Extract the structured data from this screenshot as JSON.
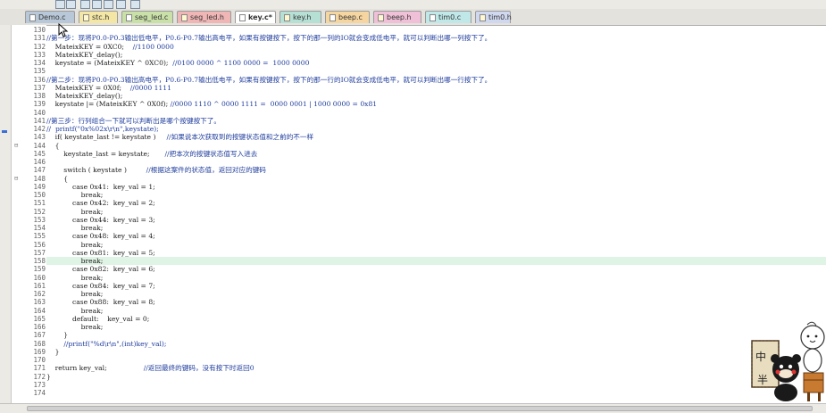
{
  "tabs": [
    {
      "label": "Demo.c",
      "kind": "c",
      "color": "#b8c8d8",
      "active": false
    },
    {
      "label": "stc.h",
      "kind": "h",
      "color": "#f4e7a6",
      "active": false
    },
    {
      "label": "seg_led.c",
      "kind": "c",
      "color": "#c9e0a8",
      "active": false
    },
    {
      "label": "seg_led.h",
      "kind": "h",
      "color": "#f0b6b6",
      "active": false
    },
    {
      "label": "key.c*",
      "kind": "c",
      "color": "#c8c4e8",
      "active": true
    },
    {
      "label": "key.h",
      "kind": "h",
      "color": "#b6e0d4",
      "active": false
    },
    {
      "label": "beep.c",
      "kind": "c",
      "color": "#f6d6a0",
      "active": false
    },
    {
      "label": "beep.h",
      "kind": "h",
      "color": "#f0c0d8",
      "active": false
    },
    {
      "label": "tim0.c",
      "kind": "c",
      "color": "#c0e8e8",
      "active": false
    },
    {
      "label": "tim0.h",
      "kind": "h",
      "color": "#d0d8f0",
      "active": false
    }
  ],
  "lines": [
    {
      "n": "130",
      "code": "",
      "comment": "",
      "fold": ""
    },
    {
      "n": "131",
      "code": "",
      "comment": "//第一步：现将P0.0-P0.3输出低电平，P0.6-P0.7输出高电平，如果有按键按下，按下的那一列的IO就会变成低电平，就可以判断出哪一列按下了。",
      "fold": ""
    },
    {
      "n": "132",
      "code": "\tMateixKEY = 0XC0;",
      "comment": "\t//1100 0000",
      "fold": ""
    },
    {
      "n": "133",
      "code": "\tMateixKEY_delay();",
      "comment": "",
      "fold": ""
    },
    {
      "n": "134",
      "code": "\tkeystate = (MateixKEY ^ 0XC0);\t",
      "comment": "//0100 0000 ^ 1100 0000 =  1000 0000",
      "fold": ""
    },
    {
      "n": "135",
      "code": "",
      "comment": "",
      "fold": ""
    },
    {
      "n": "136",
      "code": "",
      "comment": "//第二步：现将P0.0-P0.3输出高电平，P0.6-P0.7输出低电平，如果有按键按下，按下的那一行的IO就会变成低电平，就可以判断出哪一行按下了。",
      "fold": ""
    },
    {
      "n": "137",
      "code": "\tMateixKEY = 0X0f;",
      "comment": "\t//0000 1111",
      "fold": ""
    },
    {
      "n": "138",
      "code": "\tMateixKEY_delay();",
      "comment": "",
      "fold": ""
    },
    {
      "n": "139",
      "code": "\tkeystate |= (MateixKEY ^ 0X0f);\t",
      "comment": "//0000 1110 ^ 0000 1111 =  0000 0001 | 1000 0000 = 0x81",
      "fold": ""
    },
    {
      "n": "140",
      "code": "",
      "comment": "",
      "fold": ""
    },
    {
      "n": "141",
      "code": "",
      "comment": "//第三步：行列组合一下就可以判断出是哪个按键按下了。",
      "fold": ""
    },
    {
      "n": "142",
      "code": "",
      "comment": "//\tprintf(\"0x%02x\\r\\n\",keystate);",
      "fold": ""
    },
    {
      "n": "143",
      "code": "\tif( keystate_last != keystate )\t\t",
      "comment": "//如果说本次获取到的按键状态值和之前的不一样",
      "fold": ""
    },
    {
      "n": "144",
      "code": "\t{",
      "comment": "",
      "fold": "⊟"
    },
    {
      "n": "145",
      "code": "\t\tkeystate_last = keystate;\t\t",
      "comment": "//把本次的按键状态值写入进去",
      "fold": ""
    },
    {
      "n": "146",
      "code": "",
      "comment": "",
      "fold": ""
    },
    {
      "n": "147",
      "code": "\t\tswitch ( keystate )\t\t\t",
      "comment": "//根据这案件的状态值，返回对应的键码",
      "fold": ""
    },
    {
      "n": "148",
      "code": "\t\t{",
      "comment": "",
      "fold": "⊟"
    },
    {
      "n": "149",
      "code": "\t\t\tcase 0x41:\tkey_val = 1;",
      "comment": "",
      "fold": ""
    },
    {
      "n": "150",
      "code": "\t\t\t\tbreak;",
      "comment": "",
      "fold": ""
    },
    {
      "n": "151",
      "code": "\t\t\tcase 0x42:\tkey_val = 2;",
      "comment": "",
      "fold": ""
    },
    {
      "n": "152",
      "code": "\t\t\t\tbreak;",
      "comment": "",
      "fold": ""
    },
    {
      "n": "153",
      "code": "\t\t\tcase 0x44:\tkey_val = 3;",
      "comment": "",
      "fold": ""
    },
    {
      "n": "154",
      "code": "\t\t\t\tbreak;",
      "comment": "",
      "fold": ""
    },
    {
      "n": "155",
      "code": "\t\t\tcase 0x48:\tkey_val = 4;",
      "comment": "",
      "fold": ""
    },
    {
      "n": "156",
      "code": "\t\t\t\tbreak;",
      "comment": "",
      "fold": ""
    },
    {
      "n": "157",
      "code": "\t\t\tcase 0x81:\tkey_val = 5;",
      "comment": "",
      "fold": ""
    },
    {
      "n": "158",
      "code": "\t\t\t\tbreak;",
      "comment": "",
      "fold": ""
    },
    {
      "n": "159",
      "code": "\t\t\tcase 0x82:\tkey_val = 6;",
      "comment": "",
      "fold": ""
    },
    {
      "n": "160",
      "code": "\t\t\t\tbreak;",
      "comment": "",
      "fold": ""
    },
    {
      "n": "161",
      "code": "\t\t\tcase 0x84:\tkey_val = 7;",
      "comment": "",
      "fold": ""
    },
    {
      "n": "162",
      "code": "\t\t\t\tbreak;",
      "comment": "",
      "fold": ""
    },
    {
      "n": "163",
      "code": "\t\t\tcase 0x88:\tkey_val = 8;",
      "comment": "",
      "fold": ""
    },
    {
      "n": "164",
      "code": "\t\t\t\tbreak;",
      "comment": "",
      "fold": ""
    },
    {
      "n": "165",
      "code": "\t\t\tdefault:\tkey_val = 0;",
      "comment": "",
      "fold": ""
    },
    {
      "n": "166",
      "code": "\t\t\t\tbreak;",
      "comment": "",
      "fold": ""
    },
    {
      "n": "167",
      "code": "\t\t}",
      "comment": "",
      "fold": ""
    },
    {
      "n": "168",
      "code": "\t\t",
      "comment": "//printf(\"%d\\r\\n\",(int)key_val);",
      "fold": ""
    },
    {
      "n": "169",
      "code": "\t}",
      "comment": "",
      "fold": ""
    },
    {
      "n": "170",
      "code": "",
      "comment": "",
      "fold": ""
    },
    {
      "n": "171",
      "code": "\treturn key_val;\t\t\t\t\t",
      "comment": "//返回最终的键码，没有按下时返回0",
      "fold": ""
    },
    {
      "n": "172",
      "code": "}",
      "comment": "",
      "fold": ""
    },
    {
      "n": "173",
      "code": "",
      "comment": "",
      "fold": ""
    },
    {
      "n": "174",
      "code": "",
      "comment": "",
      "fold": ""
    }
  ],
  "highlighted_line": "158",
  "mascot": {
    "sign_chars": [
      "中",
      "半"
    ],
    "sign_color": "#d8c8a0"
  },
  "icons": {
    "toolbar": [
      "checkbox-icon",
      "wand-icon",
      "copy-icon",
      "paste-icon",
      "diamond-icon",
      "check-icon",
      "build-icon"
    ]
  }
}
